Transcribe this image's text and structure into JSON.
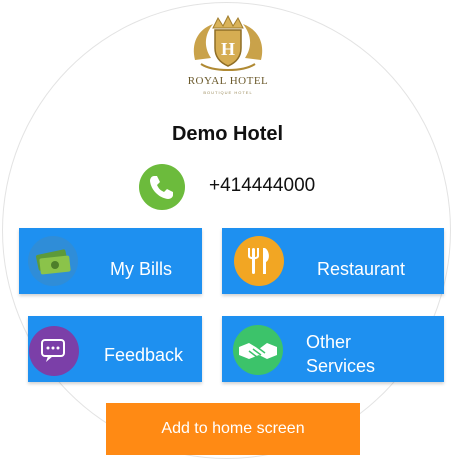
{
  "hotel": {
    "logo_name": "ROYAL HOTEL",
    "logo_sub": "BOUTIQUE HOTEL",
    "name": "Demo Hotel",
    "phone": "+414444000"
  },
  "tiles": [
    {
      "label": "My Bills",
      "icon": "money-bills-icon",
      "color": "#1e90f0"
    },
    {
      "label": "Restaurant",
      "icon": "fork-knife-icon",
      "color": "#1e90f0"
    },
    {
      "label": "Feedback",
      "icon": "feedback-icon",
      "color": "#1e90f0"
    },
    {
      "label": "Other\nServices",
      "icon": "handshake-icon",
      "color": "#1e90f0"
    }
  ],
  "add_to_home": {
    "label": "Add to home screen",
    "color": "#ff8a14"
  },
  "colors": {
    "phone_icon": "#6cbb3c",
    "logo_gold": "#c9a24a"
  }
}
